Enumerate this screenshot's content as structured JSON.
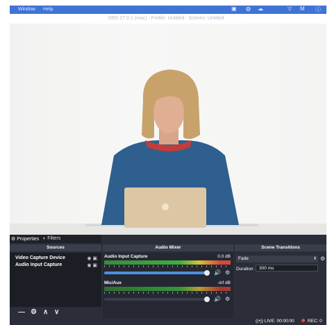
{
  "menubar": {
    "items": [
      "Window",
      "Help"
    ],
    "tray_icons": [
      "display-icon",
      "lock-icon",
      "cloud-icon",
      "shield-icon",
      "mail-icon",
      "info-icon"
    ]
  },
  "window": {
    "title": "OBS 27.0.1 (mac) - Profile: Untitled - Scenes: Untitled"
  },
  "dock": {
    "tabs": [
      {
        "label": "Properties",
        "icon": "gear-icon"
      },
      {
        "label": "Filters",
        "icon": "filter-icon"
      }
    ],
    "sources": {
      "header": "Sources",
      "items": [
        {
          "label": "Video Capture Device"
        },
        {
          "label": "Audio Input Capture"
        }
      ],
      "tools": [
        "minus-icon",
        "gear-icon",
        "up-icon",
        "down-icon"
      ]
    },
    "mixer": {
      "header": "Audio Mixer",
      "channels": [
        {
          "name": "Audio Input Capture",
          "db": "0.0 dB"
        },
        {
          "name": "Mic/Aux",
          "db": "-inf dB"
        }
      ]
    },
    "transitions": {
      "header": "Scene Transitions",
      "selected": "Fade",
      "duration_label": "Duration",
      "duration_value": "300 ms"
    }
  },
  "status": {
    "live": "LIVE: 00:00:00",
    "rec": "REC: 0"
  },
  "colors": {
    "menubar": "#3f73d6",
    "dock_bg": "#2b2e38",
    "panel_header": "#3a3e4a",
    "fader": "#4c8fe0",
    "rec": "#e64545"
  }
}
